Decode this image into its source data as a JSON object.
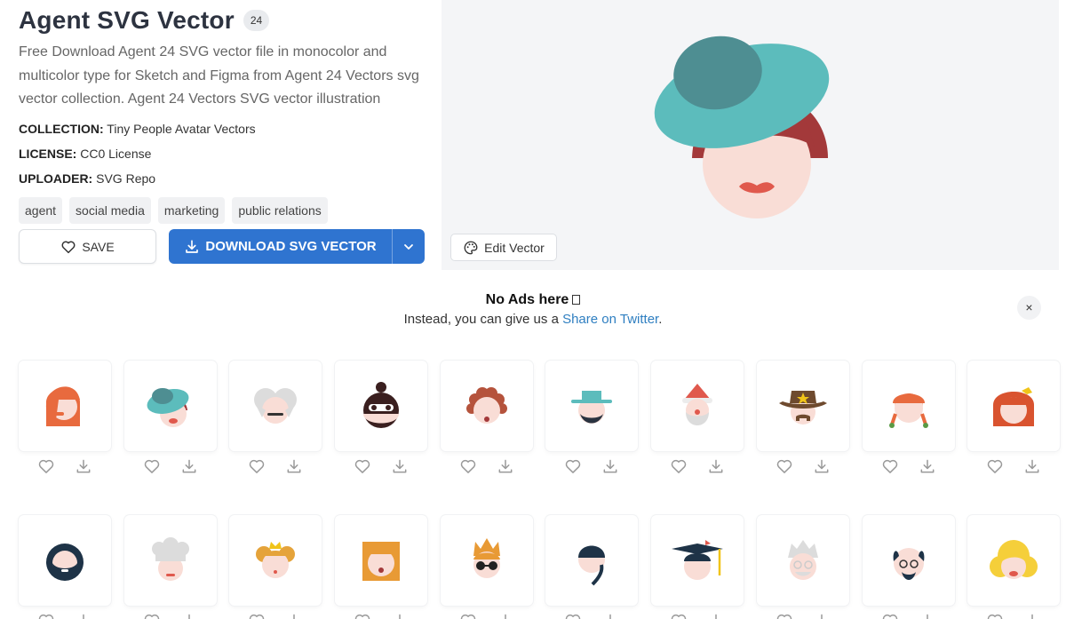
{
  "header": {
    "title": "Agent SVG Vector",
    "count": "24",
    "description": "Free Download Agent 24 SVG vector file in monocolor and multicolor type for Sketch and Figma from Agent 24 Vectors svg vector collection. Agent 24 Vectors SVG vector illustration"
  },
  "meta": {
    "collection_label": "COLLECTION:",
    "collection_value": "Tiny People Avatar Vectors",
    "license_label": "LICENSE:",
    "license_value": "CC0 License",
    "uploader_label": "UPLOADER:",
    "uploader_value": "SVG Repo"
  },
  "tags": [
    "agent",
    "social media",
    "marketing",
    "public relations"
  ],
  "actions": {
    "save_label": "SAVE",
    "download_label": "DOWNLOAD SVG VECTOR",
    "edit_label": "Edit Vector"
  },
  "notice": {
    "title": "No Ads here",
    "text_before_link": "Instead, you can give us a ",
    "link_text": "Share on Twitter",
    "text_after_link": ".",
    "close_symbol": "×"
  },
  "colors": {
    "primary_blue": "#2f74d0",
    "link_blue": "#2f7fc1",
    "skin": "#f9ddd6",
    "teal": "#5cbcbc",
    "teal_dark": "#4e8e92",
    "hair_red": "#a3393a",
    "lips": "#e0594d"
  },
  "icon_grid": [
    "red-haired-woman-icon",
    "woman-teal-hat-icon",
    "gray-haired-man-icon",
    "ninja-bun-icon",
    "curly-haired-woman-icon",
    "man-teal-hat-beard-icon",
    "santa-claus-icon",
    "sheriff-icon",
    "redhead-braids-icon",
    "red-hair-bow-woman-icon",
    "bearded-man-icon",
    "chef-icon",
    "princess-crown-icon",
    "orange-bob-woman-icon",
    "punk-sunglasses-icon",
    "braided-man-icon",
    "graduate-icon",
    "old-man-glasses-icon",
    "bald-glasses-man-icon",
    "blonde-woman-icon"
  ]
}
